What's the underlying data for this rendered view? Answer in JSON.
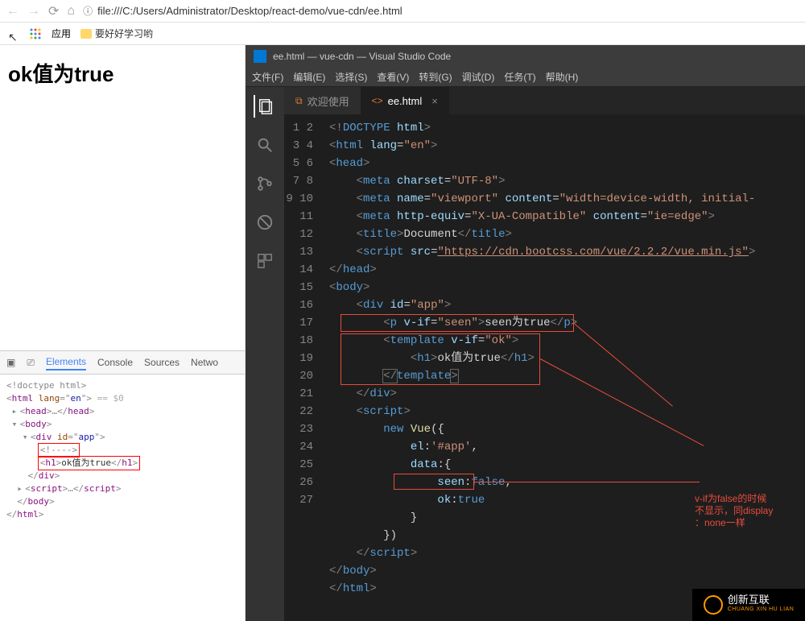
{
  "browser": {
    "url": "file:///C:/Users/Administrator/Desktop/react-demo/vue-cdn/ee.html",
    "apps_label": "应用",
    "bookmark1": "要好好学习哟"
  },
  "page": {
    "heading": "ok值为true"
  },
  "devtools": {
    "tabs": {
      "elements": "Elements",
      "console": "Console",
      "sources": "Sources",
      "network": "Netwo"
    },
    "dom": {
      "doctype": "<!doctype html>",
      "html_open": "<html lang=\"en\"> == $0",
      "head": "<head>…</head>",
      "body_open": "<body>",
      "div_open": "<div id=\"app\">",
      "comment": "<!---->",
      "h1": "<h1>ok值为true</h1>",
      "div_close": "</div>",
      "script": "<script>…</scr ipt>",
      "body_close": "</body>",
      "html_close": "</html>"
    }
  },
  "vscode": {
    "title": "ee.html — vue-cdn — Visual Studio Code",
    "menu": {
      "file": "文件(F)",
      "edit": "编辑(E)",
      "select": "选择(S)",
      "view": "查看(V)",
      "goto": "转到(G)",
      "debug": "调试(D)",
      "tasks": "任务(T)",
      "help": "帮助(H)"
    },
    "tabs": {
      "welcome": "欢迎使用",
      "ee": "ee.html"
    },
    "lines": {
      "numbers": [
        "1",
        "2",
        "3",
        "4",
        "5",
        "6",
        "7",
        "8",
        "9",
        "10",
        "11",
        "12",
        "13",
        "14",
        "15",
        "16",
        "17",
        "18",
        "19",
        "20",
        "21",
        "22",
        "23",
        "24",
        "25",
        "26",
        "27"
      ]
    },
    "annotation": "v-if为false的时候\n不显示，同display\n：none一样"
  },
  "logo": {
    "name": "创新互联",
    "sub": "CHUANG XIN HU LIAN"
  }
}
